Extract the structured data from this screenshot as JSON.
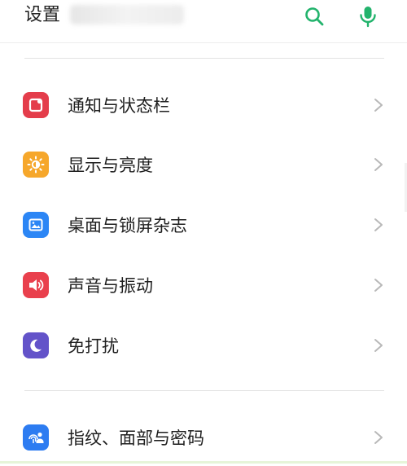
{
  "header": {
    "title": "设置",
    "search_icon": "search-icon",
    "mic_icon": "microphone-icon"
  },
  "colors": {
    "accent": "#22b36c",
    "notify": "#e43d4b",
    "display": "#f6a72b",
    "wallpaper": "#2c86f5",
    "sound": "#e9404d",
    "dnd": "#6353c9",
    "security": "#2d7cf1"
  },
  "settings": {
    "items": [
      {
        "label": "通知与状态栏",
        "icon": "notification-status-bar-icon"
      },
      {
        "label": "显示与亮度",
        "icon": "brightness-icon"
      },
      {
        "label": "桌面与锁屏杂志",
        "icon": "wallpaper-icon"
      },
      {
        "label": "声音与振动",
        "icon": "speaker-icon"
      },
      {
        "label": "免打扰",
        "icon": "moon-icon"
      },
      {
        "label": "指纹、面部与密码",
        "icon": "fingerprint-face-icon"
      }
    ]
  }
}
